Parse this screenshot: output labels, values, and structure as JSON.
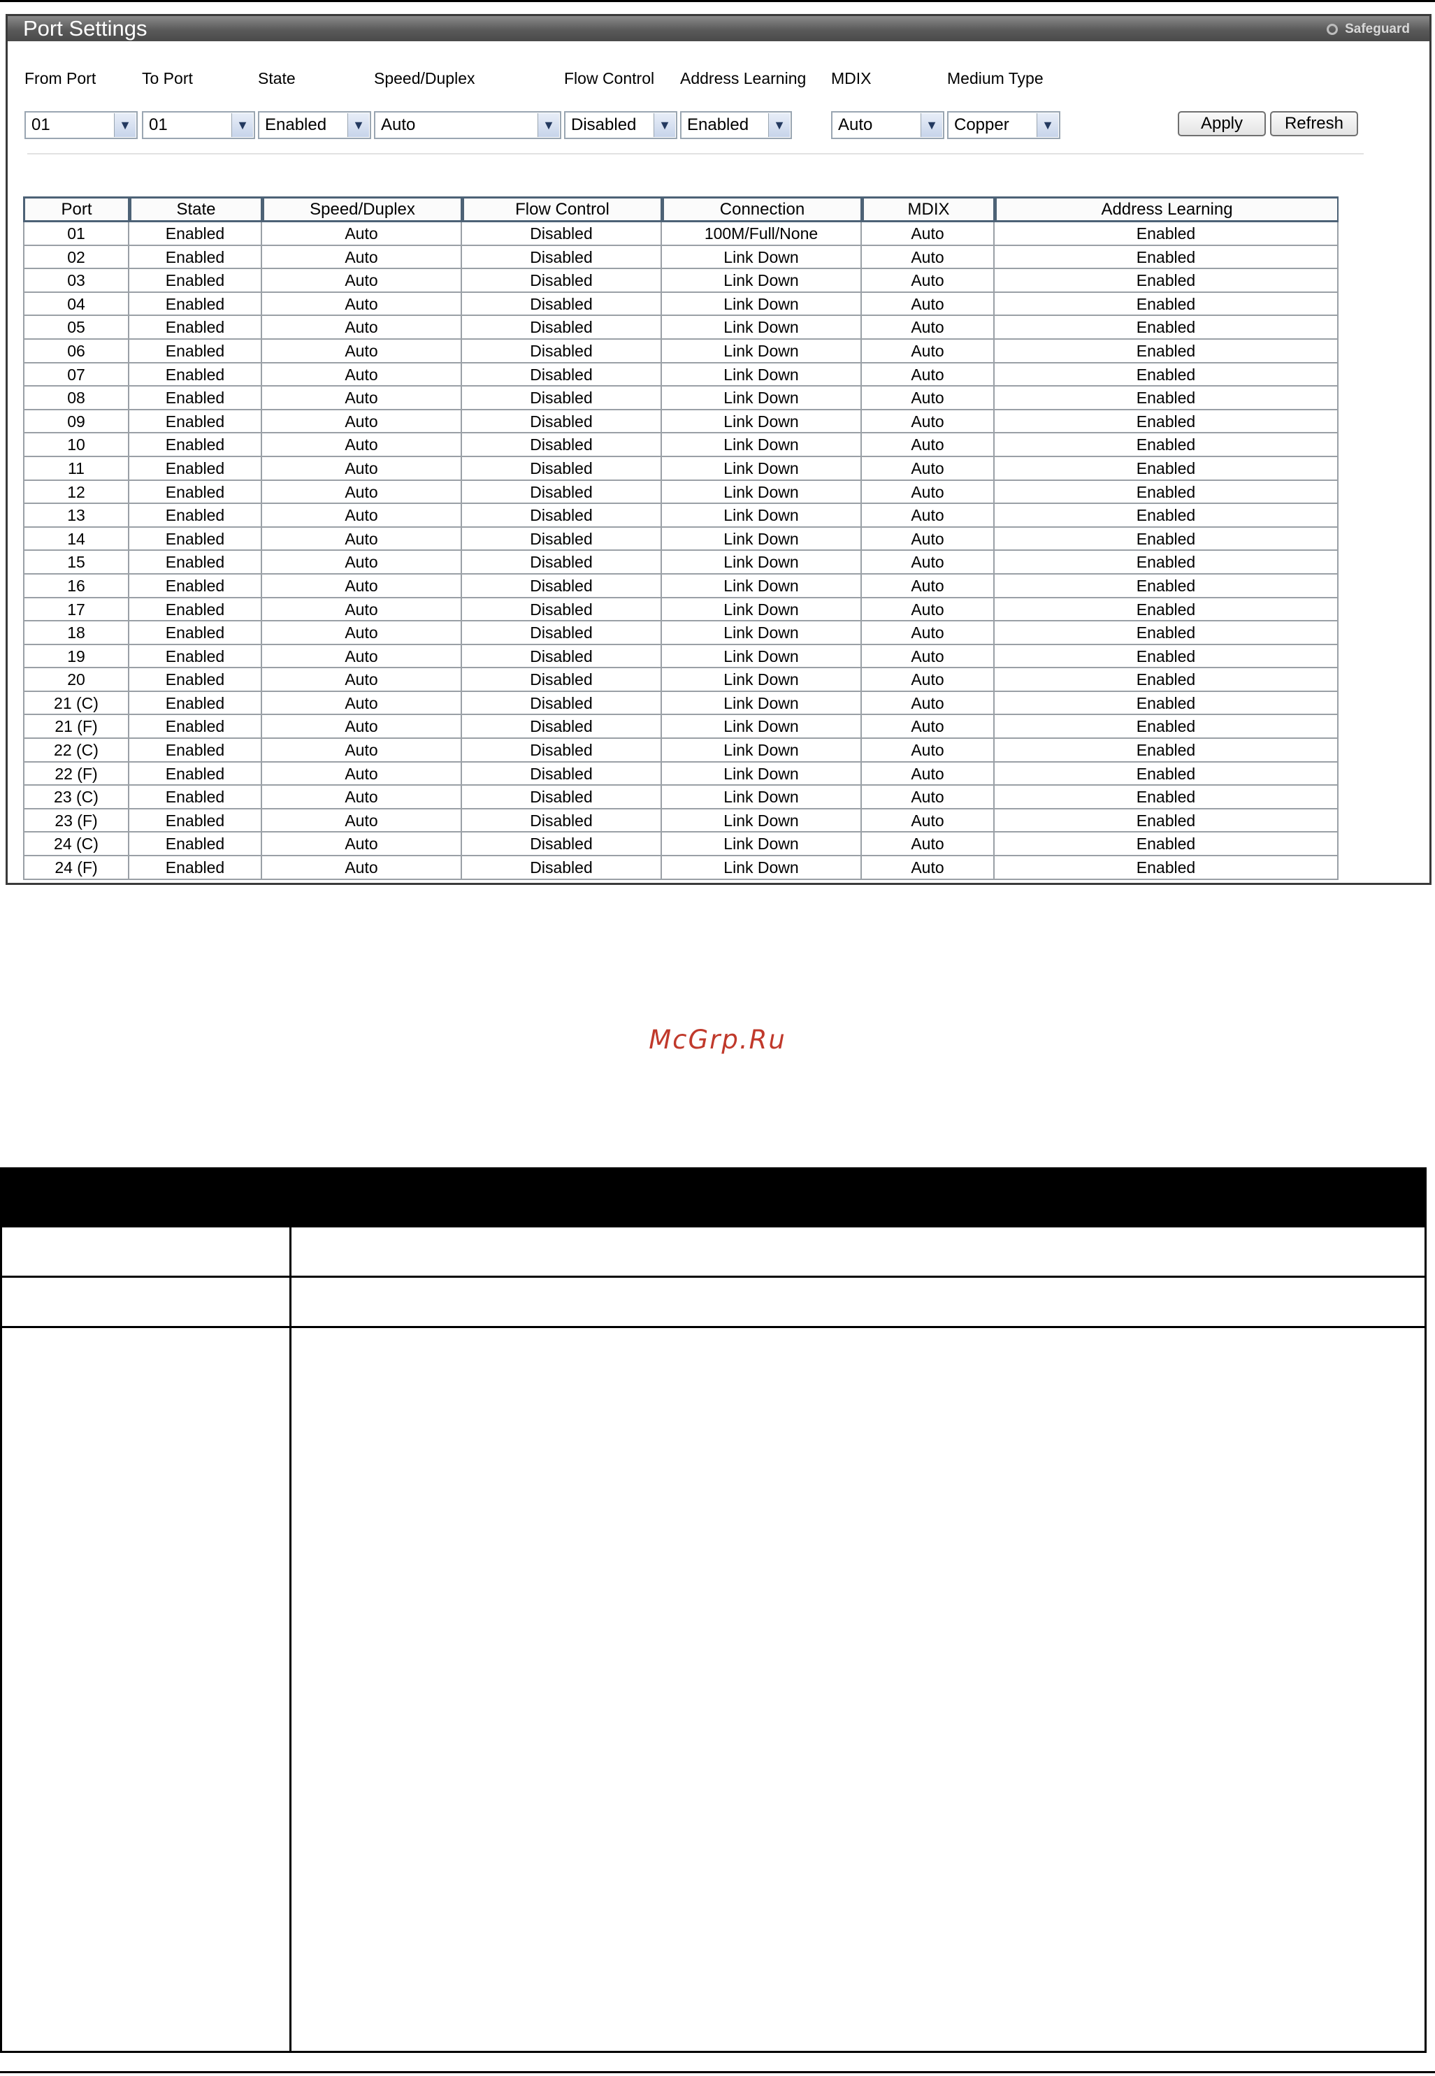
{
  "panel": {
    "title": "Port Settings",
    "safeguard": "Safeguard"
  },
  "controls": {
    "from_port": {
      "label": "From Port",
      "value": "01"
    },
    "to_port": {
      "label": "To Port",
      "value": "01"
    },
    "state": {
      "label": "State",
      "value": "Enabled"
    },
    "speed_duplex": {
      "label": "Speed/Duplex",
      "value": "Auto"
    },
    "flow_control": {
      "label": "Flow Control",
      "value": "Disabled"
    },
    "address_learning": {
      "label": "Address Learning",
      "value": "Enabled"
    },
    "mdix": {
      "label": "MDIX",
      "value": "Auto"
    },
    "medium_type": {
      "label": "Medium Type",
      "value": "Copper"
    },
    "apply_label": "Apply",
    "refresh_label": "Refresh"
  },
  "table": {
    "columns": [
      "Port",
      "State",
      "Speed/Duplex",
      "Flow Control",
      "Connection",
      "MDIX",
      "Address Learning"
    ],
    "rows": [
      [
        "01",
        "Enabled",
        "Auto",
        "Disabled",
        "100M/Full/None",
        "Auto",
        "Enabled"
      ],
      [
        "02",
        "Enabled",
        "Auto",
        "Disabled",
        "Link Down",
        "Auto",
        "Enabled"
      ],
      [
        "03",
        "Enabled",
        "Auto",
        "Disabled",
        "Link Down",
        "Auto",
        "Enabled"
      ],
      [
        "04",
        "Enabled",
        "Auto",
        "Disabled",
        "Link Down",
        "Auto",
        "Enabled"
      ],
      [
        "05",
        "Enabled",
        "Auto",
        "Disabled",
        "Link Down",
        "Auto",
        "Enabled"
      ],
      [
        "06",
        "Enabled",
        "Auto",
        "Disabled",
        "Link Down",
        "Auto",
        "Enabled"
      ],
      [
        "07",
        "Enabled",
        "Auto",
        "Disabled",
        "Link Down",
        "Auto",
        "Enabled"
      ],
      [
        "08",
        "Enabled",
        "Auto",
        "Disabled",
        "Link Down",
        "Auto",
        "Enabled"
      ],
      [
        "09",
        "Enabled",
        "Auto",
        "Disabled",
        "Link Down",
        "Auto",
        "Enabled"
      ],
      [
        "10",
        "Enabled",
        "Auto",
        "Disabled",
        "Link Down",
        "Auto",
        "Enabled"
      ],
      [
        "11",
        "Enabled",
        "Auto",
        "Disabled",
        "Link Down",
        "Auto",
        "Enabled"
      ],
      [
        "12",
        "Enabled",
        "Auto",
        "Disabled",
        "Link Down",
        "Auto",
        "Enabled"
      ],
      [
        "13",
        "Enabled",
        "Auto",
        "Disabled",
        "Link Down",
        "Auto",
        "Enabled"
      ],
      [
        "14",
        "Enabled",
        "Auto",
        "Disabled",
        "Link Down",
        "Auto",
        "Enabled"
      ],
      [
        "15",
        "Enabled",
        "Auto",
        "Disabled",
        "Link Down",
        "Auto",
        "Enabled"
      ],
      [
        "16",
        "Enabled",
        "Auto",
        "Disabled",
        "Link Down",
        "Auto",
        "Enabled"
      ],
      [
        "17",
        "Enabled",
        "Auto",
        "Disabled",
        "Link Down",
        "Auto",
        "Enabled"
      ],
      [
        "18",
        "Enabled",
        "Auto",
        "Disabled",
        "Link Down",
        "Auto",
        "Enabled"
      ],
      [
        "19",
        "Enabled",
        "Auto",
        "Disabled",
        "Link Down",
        "Auto",
        "Enabled"
      ],
      [
        "20",
        "Enabled",
        "Auto",
        "Disabled",
        "Link Down",
        "Auto",
        "Enabled"
      ],
      [
        "21 (C)",
        "Enabled",
        "Auto",
        "Disabled",
        "Link Down",
        "Auto",
        "Enabled"
      ],
      [
        "21 (F)",
        "Enabled",
        "Auto",
        "Disabled",
        "Link Down",
        "Auto",
        "Enabled"
      ],
      [
        "22 (C)",
        "Enabled",
        "Auto",
        "Disabled",
        "Link Down",
        "Auto",
        "Enabled"
      ],
      [
        "22 (F)",
        "Enabled",
        "Auto",
        "Disabled",
        "Link Down",
        "Auto",
        "Enabled"
      ],
      [
        "23 (C)",
        "Enabled",
        "Auto",
        "Disabled",
        "Link Down",
        "Auto",
        "Enabled"
      ],
      [
        "23 (F)",
        "Enabled",
        "Auto",
        "Disabled",
        "Link Down",
        "Auto",
        "Enabled"
      ],
      [
        "24 (C)",
        "Enabled",
        "Auto",
        "Disabled",
        "Link Down",
        "Auto",
        "Enabled"
      ],
      [
        "24 (F)",
        "Enabled",
        "Auto",
        "Disabled",
        "Link Down",
        "Auto",
        "Enabled"
      ]
    ]
  },
  "watermark": "McGrp.Ru",
  "colors": {
    "header_gradient_top": "#8a8a8a",
    "header_gradient_bottom": "#4a4a4a",
    "table_header_border": "#4d6276",
    "watermark": "#c0392b"
  }
}
